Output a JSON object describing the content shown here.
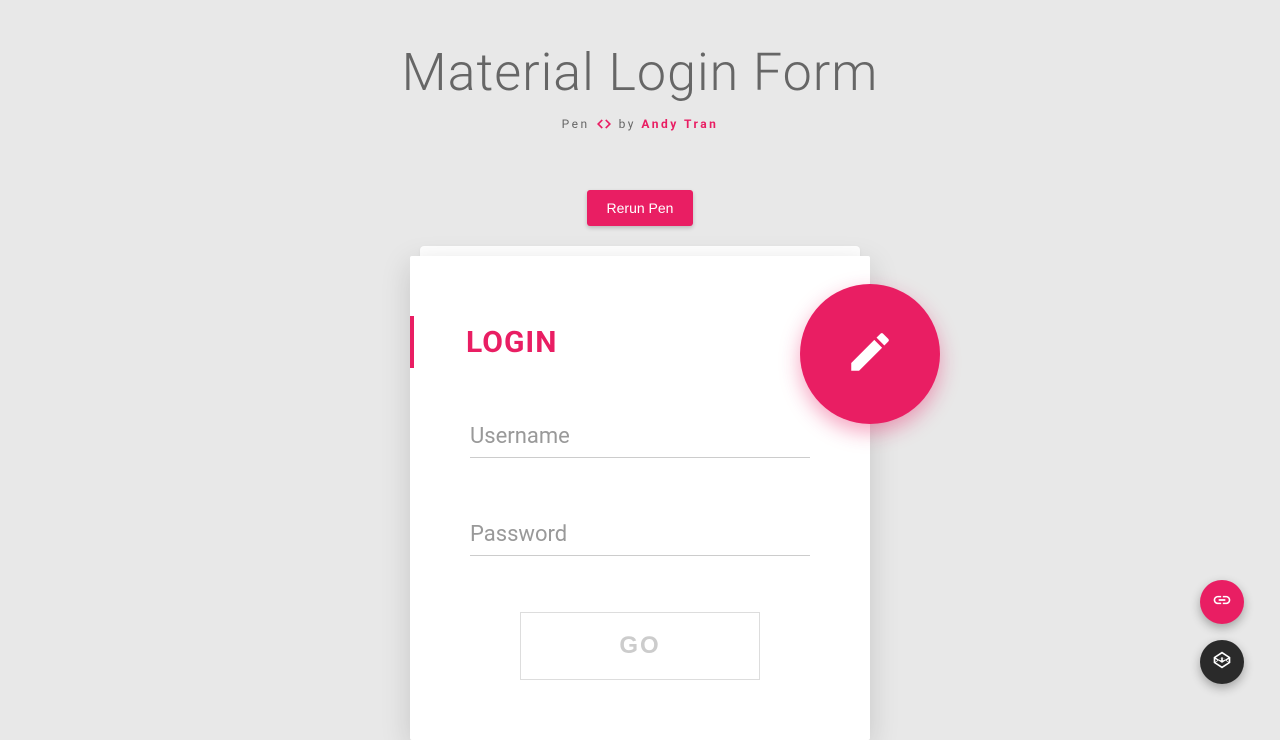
{
  "header": {
    "title": "Material Login Form",
    "subtitle_prefix": "Pen",
    "subtitle_by": "by",
    "author": "Andy Tran",
    "rerun_label": "Rerun Pen"
  },
  "card": {
    "login_label": "LOGIN",
    "username_placeholder": "Username",
    "password_placeholder": "Password",
    "go_label": "GO"
  },
  "colors": {
    "accent": "#e91e63",
    "bg": "#e8e8e8"
  }
}
